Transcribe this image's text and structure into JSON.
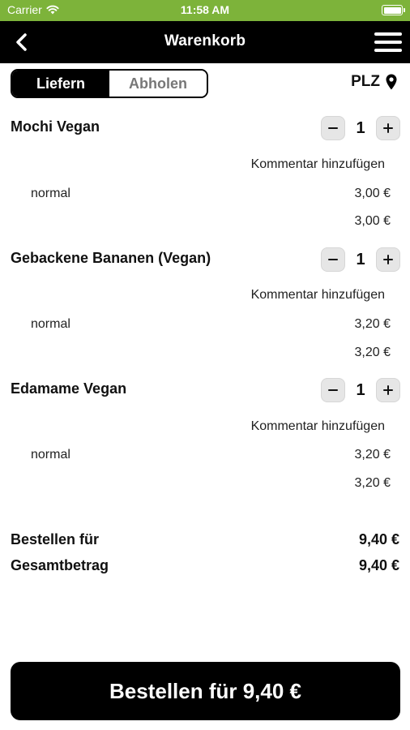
{
  "status_bar": {
    "carrier": "Carrier",
    "time": "11:58 AM"
  },
  "nav": {
    "title": "Warenkorb",
    "back_icon": "chevron-left-icon",
    "menu_icon": "hamburger-menu-icon"
  },
  "delivery_toggle": {
    "options": [
      "Liefern",
      "Abholen"
    ],
    "selected": "Liefern"
  },
  "plz": {
    "label": "PLZ",
    "icon": "location-pin-icon"
  },
  "cart": {
    "items": [
      {
        "name": "Mochi Vegan",
        "quantity": "1",
        "comment_link": "Kommentar hinzufügen",
        "variant": "normal",
        "variant_price": "3,00 €",
        "item_total": "3,00 €"
      },
      {
        "name": "Gebackene Bananen (Vegan)",
        "quantity": "1",
        "comment_link": "Kommentar hinzufügen",
        "variant": "normal",
        "variant_price": "3,20 €",
        "item_total": "3,20 €"
      },
      {
        "name": "Edamame Vegan",
        "quantity": "1",
        "comment_link": "Kommentar hinzufügen",
        "variant": "normal",
        "variant_price": "3,20 €",
        "item_total": "3,20 €"
      }
    ]
  },
  "summary": {
    "order_for_label": "Bestellen für",
    "order_for_value": "9,40 €",
    "total_label": "Gesamtbetrag",
    "total_value": "9,40 €"
  },
  "order_button": {
    "label": "Bestellen für 9,40 €"
  },
  "colors": {
    "status_bar": "#7db33a",
    "nav_bar": "#000000",
    "button": "#000000",
    "stepper_bg": "#e6e6e6"
  }
}
